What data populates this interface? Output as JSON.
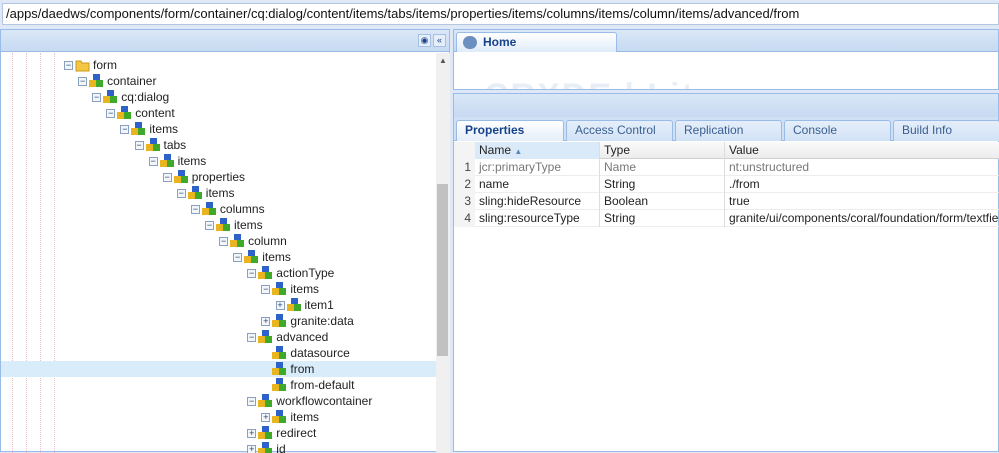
{
  "address_bar": {
    "path": "/apps/daedws/components/form/container/cq:dialog/content/items/tabs/items/properties/items/columns/items/column/items/advanced/from"
  },
  "tree": {
    "toolbar": {
      "find_icon": "binoculars-icon",
      "collapse_icon": "double-chevron-left-icon"
    },
    "nodes": [
      {
        "label": "form",
        "level": 0,
        "toggle": "minus",
        "icon": "folder"
      },
      {
        "label": "container",
        "level": 1,
        "toggle": "minus",
        "icon": "node"
      },
      {
        "label": "cq:dialog",
        "level": 2,
        "toggle": "minus",
        "icon": "node"
      },
      {
        "label": "content",
        "level": 3,
        "toggle": "minus",
        "icon": "node"
      },
      {
        "label": "items",
        "level": 4,
        "toggle": "minus",
        "icon": "node"
      },
      {
        "label": "tabs",
        "level": 5,
        "toggle": "minus",
        "icon": "node"
      },
      {
        "label": "items",
        "level": 6,
        "toggle": "minus",
        "icon": "node"
      },
      {
        "label": "properties",
        "level": 7,
        "toggle": "minus",
        "icon": "node"
      },
      {
        "label": "items",
        "level": 8,
        "toggle": "minus",
        "icon": "node"
      },
      {
        "label": "columns",
        "level": 9,
        "toggle": "minus",
        "icon": "node"
      },
      {
        "label": "items",
        "level": 10,
        "toggle": "minus",
        "icon": "node"
      },
      {
        "label": "column",
        "level": 11,
        "toggle": "minus",
        "icon": "node"
      },
      {
        "label": "items",
        "level": 12,
        "toggle": "minus",
        "icon": "node"
      },
      {
        "label": "actionType",
        "level": 13,
        "toggle": "minus",
        "icon": "node"
      },
      {
        "label": "items",
        "level": 14,
        "toggle": "minus",
        "icon": "node"
      },
      {
        "label": "item1",
        "level": 15,
        "toggle": "plus",
        "icon": "node"
      },
      {
        "label": "granite:data",
        "level": 14,
        "toggle": "plus",
        "icon": "node"
      },
      {
        "label": "advanced",
        "level": 13,
        "toggle": "minus",
        "icon": "node"
      },
      {
        "label": "datasource",
        "level": 14,
        "toggle": "none",
        "icon": "node"
      },
      {
        "label": "from",
        "level": 14,
        "toggle": "none",
        "icon": "node",
        "selected": true
      },
      {
        "label": "from-default",
        "level": 14,
        "toggle": "none",
        "icon": "node"
      },
      {
        "label": "workflowcontainer",
        "level": 13,
        "toggle": "minus",
        "icon": "node"
      },
      {
        "label": "items",
        "level": 14,
        "toggle": "plus",
        "icon": "node"
      },
      {
        "label": "redirect",
        "level": 13,
        "toggle": "plus",
        "icon": "node"
      },
      {
        "label": "id",
        "level": 13,
        "toggle": "plus",
        "icon": "node"
      }
    ]
  },
  "home_tab": {
    "label": "Home",
    "icon": "home-icon"
  },
  "properties_tabs": [
    "Properties",
    "Access Control",
    "Replication",
    "Console",
    "Build Info"
  ],
  "grid": {
    "columns": [
      "Name",
      "Type",
      "Value"
    ],
    "sort": "Name ascending",
    "rows": [
      {
        "n": "1",
        "name": "jcr:primaryType",
        "type": "Name",
        "value": "nt:unstructured"
      },
      {
        "n": "2",
        "name": "name",
        "type": "String",
        "value": "./from"
      },
      {
        "n": "3",
        "name": "sling:hideResource",
        "type": "Boolean",
        "value": "true"
      },
      {
        "n": "4",
        "name": "sling:resourceType",
        "type": "String",
        "value": "granite/ui/components/coral/foundation/form/textfield"
      }
    ]
  },
  "colors": {
    "accent": "#15428b",
    "selected_row": "#d9ecfa",
    "panel_border": "#99bbe8"
  }
}
